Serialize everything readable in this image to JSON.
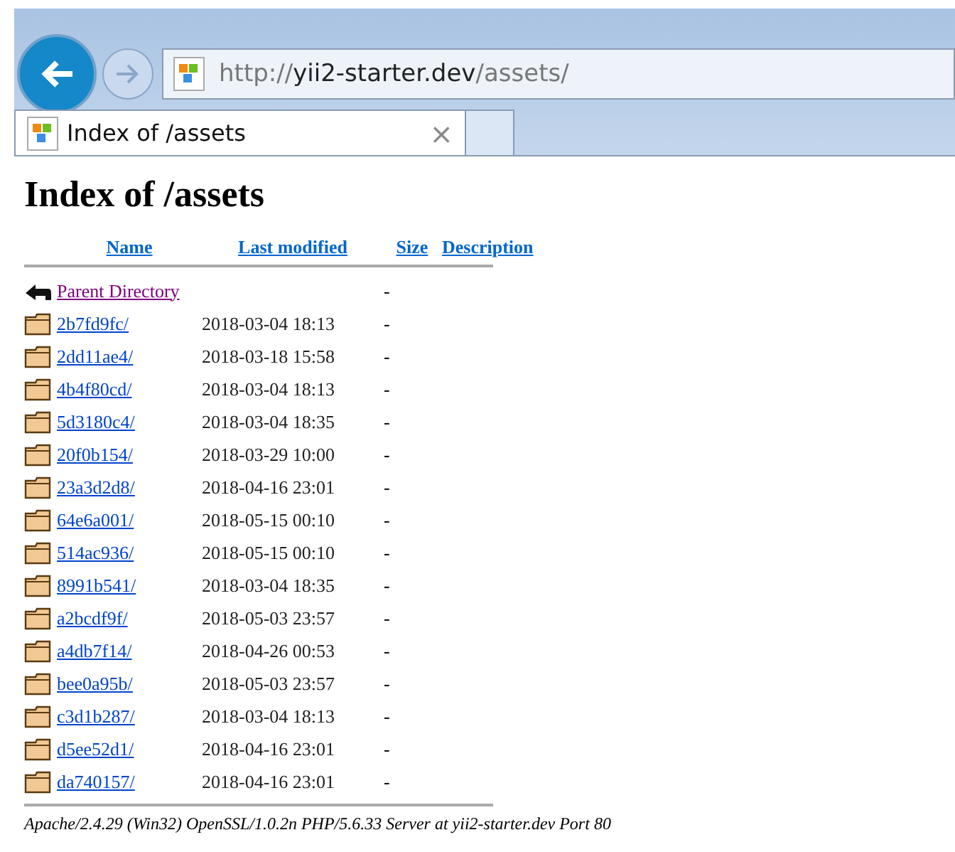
{
  "browser": {
    "address": {
      "scheme": "http://",
      "host": "yii2-starter.dev",
      "path": "/assets/"
    },
    "tabs": [
      {
        "title": "Index of /assets",
        "selected": true,
        "close": "×"
      }
    ]
  },
  "page": {
    "heading": "Index of /assets",
    "columns": [
      "Name",
      "Last modified",
      "Size",
      "Description"
    ],
    "rows": [
      {
        "kind": "parent",
        "name": "Parent Directory",
        "modified": "",
        "size": "-",
        "visited": true
      },
      {
        "kind": "folder",
        "name": "2b7fd9fc/",
        "modified": "2018-03-04 18:13",
        "size": "-",
        "visited": false
      },
      {
        "kind": "folder",
        "name": "2dd11ae4/",
        "modified": "2018-03-18 15:58",
        "size": "-",
        "visited": false
      },
      {
        "kind": "folder",
        "name": "4b4f80cd/",
        "modified": "2018-03-04 18:13",
        "size": "-",
        "visited": false
      },
      {
        "kind": "folder",
        "name": "5d3180c4/",
        "modified": "2018-03-04 18:35",
        "size": "-",
        "visited": false
      },
      {
        "kind": "folder",
        "name": "20f0b154/",
        "modified": "2018-03-29 10:00",
        "size": "-",
        "visited": false
      },
      {
        "kind": "folder",
        "name": "23a3d2d8/",
        "modified": "2018-04-16 23:01",
        "size": "-",
        "visited": false
      },
      {
        "kind": "folder",
        "name": "64e6a001/",
        "modified": "2018-05-15 00:10",
        "size": "-",
        "visited": false
      },
      {
        "kind": "folder",
        "name": "514ac936/",
        "modified": "2018-05-15 00:10",
        "size": "-",
        "visited": false
      },
      {
        "kind": "folder",
        "name": "8991b541/",
        "modified": "2018-03-04 18:35",
        "size": "-",
        "visited": false
      },
      {
        "kind": "folder",
        "name": "a2bcdf9f/",
        "modified": "2018-05-03 23:57",
        "size": "-",
        "visited": false
      },
      {
        "kind": "folder",
        "name": "a4db7f14/",
        "modified": "2018-04-26 00:53",
        "size": "-",
        "visited": false
      },
      {
        "kind": "folder",
        "name": "bee0a95b/",
        "modified": "2018-05-03 23:57",
        "size": "-",
        "visited": false
      },
      {
        "kind": "folder",
        "name": "c3d1b287/",
        "modified": "2018-03-04 18:13",
        "size": "-",
        "visited": false
      },
      {
        "kind": "folder",
        "name": "d5ee52d1/",
        "modified": "2018-04-16 23:01",
        "size": "-",
        "visited": false
      },
      {
        "kind": "folder",
        "name": "da740157/",
        "modified": "2018-04-16 23:01",
        "size": "-",
        "visited": false
      }
    ],
    "footer": "Apache/2.4.29 (Win32) OpenSSL/1.0.2n PHP/5.6.33 Server at yii2-starter.dev Port 80"
  }
}
